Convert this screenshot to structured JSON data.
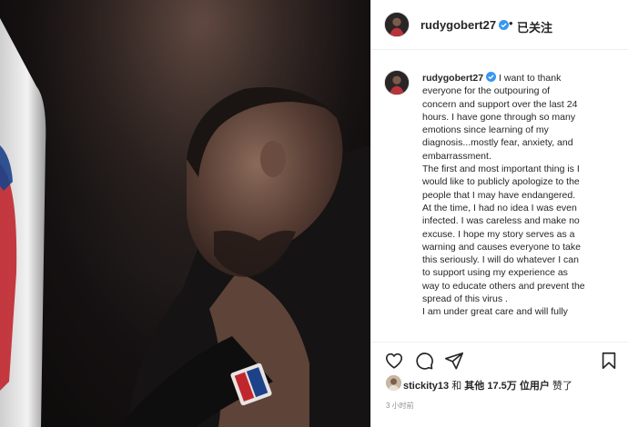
{
  "post": {
    "username": "rudygobert27",
    "follow_state": "已关注",
    "header_separator": "•",
    "caption_lines": [
      "I want to thank",
      "everyone for the outpouring of",
      "concern and support over the last 24",
      "hours. I have gone through so many",
      "emotions since learning of my",
      "diagnosis...mostly fear, anxiety, and",
      "embarrassment.",
      "The first and most important thing is I",
      "would like to publicly apologize to the",
      "people that I may have endangered.",
      "At the time, I had no idea I was even",
      "infected. I was careless and make no",
      "excuse. I hope my story serves as a",
      "warning and causes everyone to take",
      "this seriously. I will do whatever I can",
      "to support using my experience as",
      "way to educate others and prevent the",
      "spread of this virus .",
      "I am under great care and will fully"
    ],
    "likes": {
      "liker": "stickity13",
      "and": "和",
      "others_label": "其他",
      "count": "17.5万",
      "users_suffix": "位用户",
      "liked": "赞了"
    },
    "timestamp": "3 小时前"
  },
  "icons": {
    "verified": "verified-badge-icon",
    "like": "heart-icon",
    "comment": "comment-icon",
    "share": "paper-plane-icon",
    "save": "bookmark-icon"
  },
  "colors": {
    "verified_blue": "#3897f0",
    "text": "#262626",
    "muted": "#8e8e8e",
    "divider": "#efefef"
  }
}
